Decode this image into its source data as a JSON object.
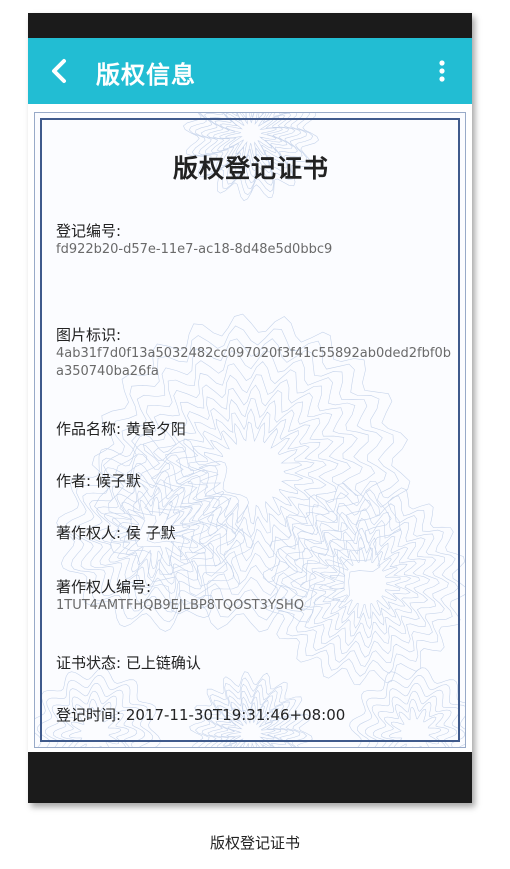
{
  "app_bar": {
    "title": "版权信息",
    "back_icon": "chevron-left-icon",
    "menu_icon": "more-vertical-icon",
    "color": "#22bdd3"
  },
  "certificate": {
    "title": "版权登记证书",
    "registration_no_label": "登记编号:",
    "registration_no": "fd922b20-d57e-11e7-ac18-8d48e5d0bbc9",
    "image_id_label": "图片标识:",
    "image_id": "4ab31f7d0f13a5032482cc097020f3f41c55892ab0ded2fbf0ba350740ba26fa",
    "work_name": "作品名称: 黄昏夕阳",
    "author": "作者: 候子默",
    "copyright_owner": "著作权人: 侯 子默",
    "owner_no_label": "著作权人编号:",
    "owner_no": "1TUT4AMTFHQB9EJLBP8TQOST3YSHQ",
    "status": "证书状态: 已上链确认",
    "reg_time": "登记时间: 2017-11-30T19:31:46+08:00"
  },
  "caption": "版权登记证书"
}
